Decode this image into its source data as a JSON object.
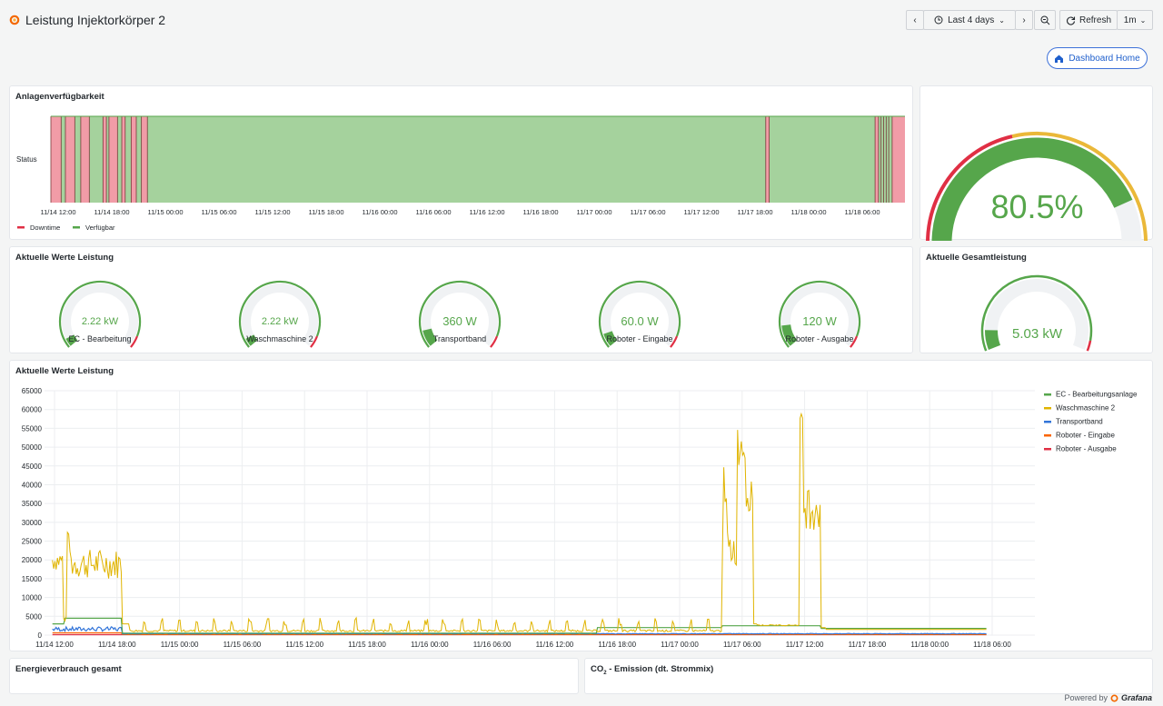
{
  "header": {
    "title": "Leistung Injektorkörper 2",
    "time_range": "Last 4 days",
    "refresh_label": "Refresh",
    "refresh_interval": "1m",
    "dashboard_home": "Dashboard Home"
  },
  "availability_panel": {
    "title": "Anlagenverfügbarkeit",
    "row_label": "Status",
    "x_ticks": [
      "11/14 12:00",
      "11/14 18:00",
      "11/15 00:00",
      "11/15 06:00",
      "11/15 12:00",
      "11/15 18:00",
      "11/16 00:00",
      "11/16 06:00",
      "11/16 12:00",
      "11/16 18:00",
      "11/17 00:00",
      "11/17 06:00",
      "11/17 12:00",
      "11/17 18:00",
      "11/18 00:00",
      "11/18 06:00"
    ],
    "legend": [
      {
        "label": "Downtime",
        "color": "#e02f44"
      },
      {
        "label": "Verfügbar",
        "color": "#56a64b"
      }
    ]
  },
  "availability_gauge": {
    "value": 80.5,
    "value_text": "80.5%"
  },
  "current_values_panel": {
    "title": "Aktuelle Werte Leistung",
    "gauges": [
      {
        "label": "EC - Bearbeitung",
        "value_text": "2.22 kW",
        "fraction": 0.05
      },
      {
        "label": "Waschmaschine 2",
        "value_text": "2.22 kW",
        "fraction": 0.05
      },
      {
        "label": "Transportband",
        "value_text": "360 W",
        "fraction": 0.1
      },
      {
        "label": "Roboter - Eingabe",
        "value_text": "60.0 W",
        "fraction": 0.08
      },
      {
        "label": "Roboter - Ausgabe",
        "value_text": "120 W",
        "fraction": 0.13
      }
    ]
  },
  "total_panel": {
    "title": "Aktuelle Gesamtleistung",
    "value_text": "5.03 kW",
    "fraction": 0.1
  },
  "chart_panel": {
    "title": "Aktuelle Werte Leistung"
  },
  "chart_data": {
    "type": "line",
    "x_ticks": [
      "11/14 12:00",
      "11/14 18:00",
      "11/15 00:00",
      "11/15 06:00",
      "11/15 12:00",
      "11/15 18:00",
      "11/16 00:00",
      "11/16 06:00",
      "11/16 12:00",
      "11/16 18:00",
      "11/17 00:00",
      "11/17 06:00",
      "11/17 12:00",
      "11/17 18:00",
      "11/18 00:00",
      "11/18 06:00"
    ],
    "y_ticks": [
      0,
      5000,
      10000,
      15000,
      20000,
      25000,
      30000,
      35000,
      40000,
      45000,
      50000,
      55000,
      60000,
      65000
    ],
    "ylim": [
      0,
      65000
    ],
    "grid": true,
    "legend_position": "right",
    "series": [
      {
        "name": "EC - Bearbeitungsanlage",
        "color": "#56a64b"
      },
      {
        "name": "Waschmaschine 2",
        "color": "#e0b400"
      },
      {
        "name": "Transportband",
        "color": "#3274d9"
      },
      {
        "name": "Roboter - Eingabe",
        "color": "#fa6400"
      },
      {
        "name": "Roboter - Ausgabe",
        "color": "#e02f44"
      }
    ]
  },
  "bottom_panels": {
    "energy_title": "Energieverbrauch gesamt",
    "co2_title_prefix": "CO",
    "co2_subscript": "2",
    "co2_title_suffix": " - Emission (dt. Strommix)"
  },
  "footer": {
    "powered_by": "Powered by",
    "brand": "Grafana"
  }
}
